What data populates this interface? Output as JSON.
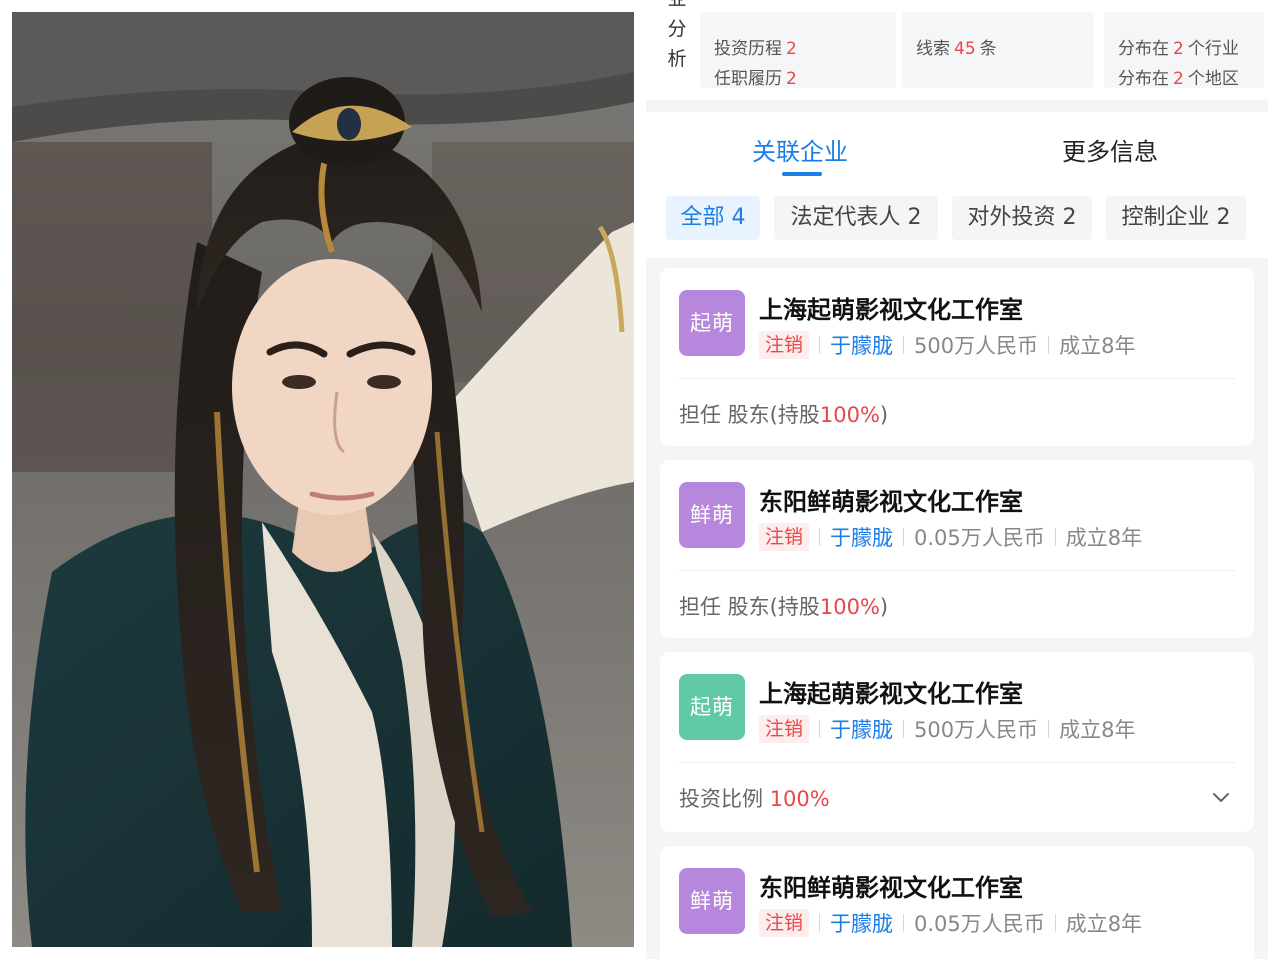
{
  "analysis": {
    "label_chars": [
      "业",
      "分",
      "析"
    ],
    "stats": {
      "invest_history": {
        "label": "投资历程",
        "value": "2"
      },
      "employment": {
        "label": "任职履历",
        "value": "2"
      },
      "clues": {
        "label": "线索",
        "value": "45",
        "unit": "条"
      },
      "industry": {
        "prefix": "分布在",
        "value": "2",
        "suffix": "个行业"
      },
      "region": {
        "prefix": "分布在",
        "value": "2",
        "suffix": "个地区"
      }
    }
  },
  "tabs": [
    {
      "label": "关联企业",
      "active": true
    },
    {
      "label": "更多信息",
      "active": false
    }
  ],
  "chips": [
    {
      "label": "全部 4",
      "active": true
    },
    {
      "label": "法定代表人 2",
      "active": false
    },
    {
      "label": "对外投资 2",
      "active": false
    },
    {
      "label": "控制企业 2",
      "active": false
    }
  ],
  "companies": [
    {
      "logo": "起萌",
      "logo_color": "#b687dd",
      "name": "上海起萌影视文化工作室",
      "status": "注销",
      "person": "于朦胧",
      "capital": "500万人民币",
      "age": "成立8年",
      "role_prefix": "担任 股东(持股",
      "role_value": "100%",
      "role_suffix": ")"
    },
    {
      "logo": "鲜萌",
      "logo_color": "#b687dd",
      "name": "东阳鲜萌影视文化工作室",
      "status": "注销",
      "person": "于朦胧",
      "capital": "0.05万人民币",
      "age": "成立8年",
      "role_prefix": "担任 股东(持股",
      "role_value": "100%",
      "role_suffix": ")"
    },
    {
      "logo": "起萌",
      "logo_color": "#5fcaa4",
      "name": "上海起萌影视文化工作室",
      "status": "注销",
      "person": "于朦胧",
      "capital": "500万人民币",
      "age": "成立8年",
      "role_prefix": "投资比例",
      "role_value": "100%",
      "role_suffix": "",
      "expand_icon": "chevron-down-icon"
    },
    {
      "logo": "鲜萌",
      "logo_color": "#b687dd",
      "name": "东阳鲜萌影视文化工作室",
      "status": "注销",
      "person": "于朦胧",
      "capital": "0.05万人民币",
      "age": "成立8年"
    }
  ],
  "colors": {
    "accent": "#1a7ee6",
    "highlight_red": "#e9474a",
    "logo_purple": "#b687dd",
    "logo_green": "#5fcaa4"
  }
}
